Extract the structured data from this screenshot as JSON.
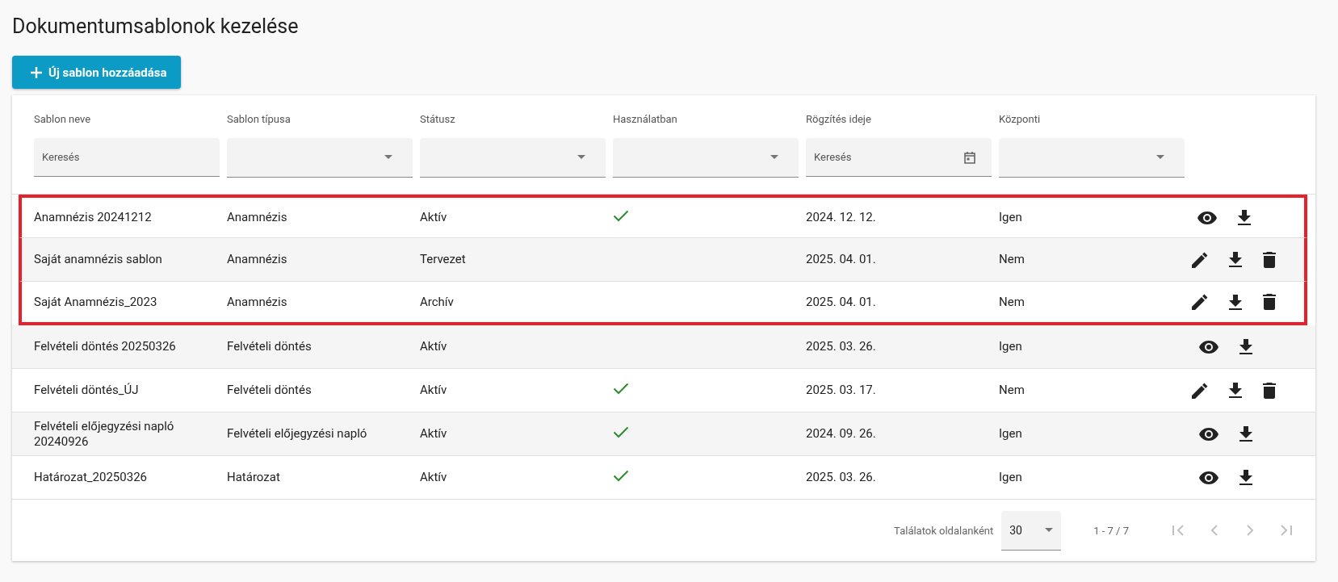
{
  "page_title": "Dokumentumsablonok kezelése",
  "add_button": {
    "label": "Új sablon hozzáadása"
  },
  "filters": [
    {
      "label": "Sablon neve",
      "kind": "text",
      "placeholder": "Keresés"
    },
    {
      "label": "Sablon típusa",
      "kind": "select"
    },
    {
      "label": "Státusz",
      "kind": "select"
    },
    {
      "label": "Használatban",
      "kind": "select"
    },
    {
      "label": "Rögzítés ideje",
      "kind": "date",
      "placeholder": "Keresés"
    },
    {
      "label": "Központi",
      "kind": "select"
    }
  ],
  "rows": [
    {
      "name": "Anamnézis 20241212",
      "type": "Anamnézis",
      "status": "Aktív",
      "in_use": true,
      "date": "2024. 12. 12.",
      "central": "Igen",
      "actions": [
        {
          "kind": "view"
        },
        {
          "kind": "download"
        }
      ],
      "highlighted": true
    },
    {
      "name": "Saját anamnézis sablon",
      "type": "Anamnézis",
      "status": "Tervezet",
      "in_use": false,
      "date": "2025. 04. 01.",
      "central": "Nem",
      "actions": [
        {
          "kind": "edit"
        },
        {
          "kind": "download"
        },
        {
          "kind": "delete"
        }
      ],
      "highlighted": true
    },
    {
      "name": "Saját Anamnézis_2023",
      "type": "Anamnézis",
      "status": "Archív",
      "in_use": false,
      "date": "2025. 04. 01.",
      "central": "Nem",
      "actions": [
        {
          "kind": "edit"
        },
        {
          "kind": "download"
        },
        {
          "kind": "delete"
        }
      ],
      "highlighted": true
    },
    {
      "name": "Felvételi döntés 20250326",
      "type": "Felvételi döntés",
      "status": "Aktív",
      "in_use": false,
      "date": "2025. 03. 26.",
      "central": "Igen",
      "actions": [
        {
          "kind": "view"
        },
        {
          "kind": "download"
        }
      ],
      "highlighted": false
    },
    {
      "name": "Felvételi döntés_ÚJ",
      "type": "Felvételi döntés",
      "status": "Aktív",
      "in_use": true,
      "date": "2025. 03. 17.",
      "central": "Nem",
      "actions": [
        {
          "kind": "edit"
        },
        {
          "kind": "download"
        },
        {
          "kind": "delete"
        }
      ],
      "highlighted": false
    },
    {
      "name": "Felvételi előjegyzési napló 20240926",
      "type": "Felvételi előjegyzési napló",
      "status": "Aktív",
      "in_use": true,
      "date": "2024. 09. 26.",
      "central": "Igen",
      "actions": [
        {
          "kind": "view"
        },
        {
          "kind": "download"
        }
      ],
      "highlighted": false
    },
    {
      "name": "Határozat_20250326",
      "type": "Határozat",
      "status": "Aktív",
      "in_use": true,
      "date": "2025. 03. 26.",
      "central": "Igen",
      "actions": [
        {
          "kind": "view"
        },
        {
          "kind": "download"
        }
      ],
      "highlighted": false
    }
  ],
  "paginator": {
    "page_size_label": "Találatok oldalanként",
    "page_size": "30",
    "range": "1 - 7 / 7",
    "first_disabled": true,
    "prev_disabled": true,
    "next_disabled": true,
    "last_disabled": true
  }
}
